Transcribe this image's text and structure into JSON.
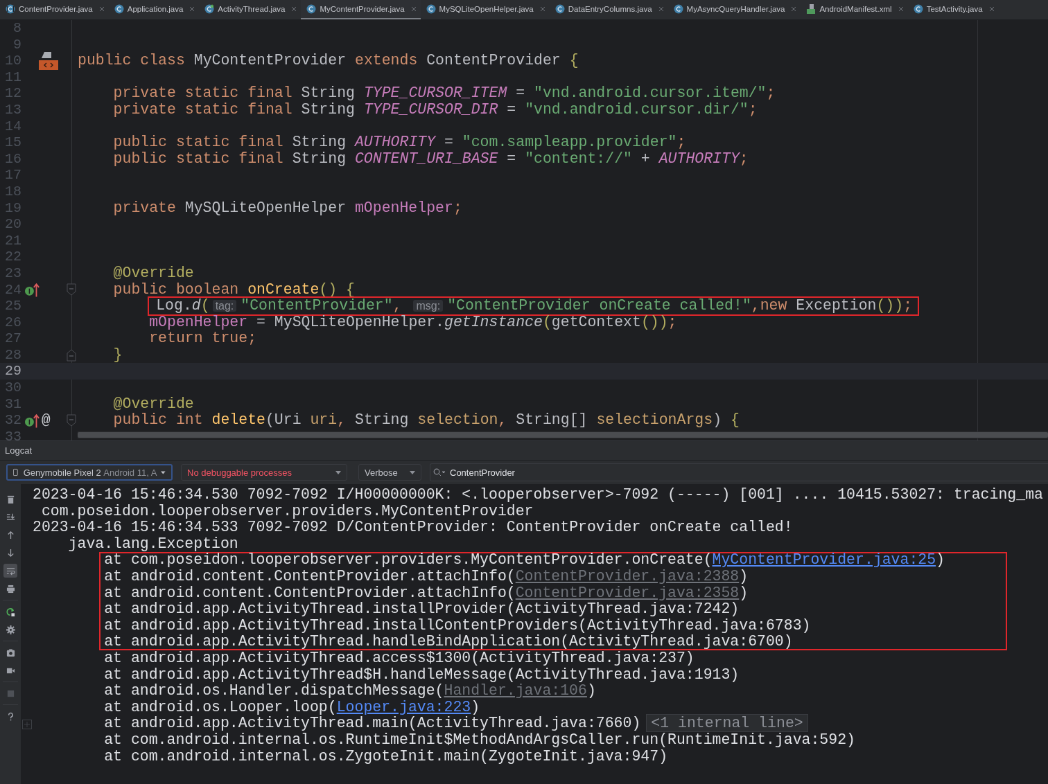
{
  "tabs": [
    {
      "label": "ContentProvider.java",
      "kind": "library_class",
      "selected": false
    },
    {
      "label": "Application.java",
      "kind": "class",
      "selected": false
    },
    {
      "label": "ActivityThread.java",
      "kind": "class_modified",
      "selected": false
    },
    {
      "label": "MyContentProvider.java",
      "kind": "class",
      "selected": true
    },
    {
      "label": "MySQLiteOpenHelper.java",
      "kind": "class",
      "selected": false
    },
    {
      "label": "DataEntryColumns.java",
      "kind": "class",
      "selected": false
    },
    {
      "label": "MyAsyncQueryHandler.java",
      "kind": "class",
      "selected": false
    },
    {
      "label": "AndroidManifest.xml",
      "kind": "manifest",
      "selected": false
    },
    {
      "label": "TestActivity.java",
      "kind": "class",
      "selected": false
    }
  ],
  "editor": {
    "lines": [
      {
        "number": "8",
        "kind": "blank",
        "current": false
      },
      {
        "number": "9",
        "kind": "blank",
        "current": false
      },
      {
        "number": "10",
        "kind": "class_declaration",
        "current": false,
        "tokens": [
          {
            "kind": "kw",
            "text": "public class "
          },
          {
            "kind": "plain",
            "text": "MyContentProvider "
          },
          {
            "kind": "kw",
            "text": "extends "
          },
          {
            "kind": "plain",
            "text": "ContentProvider "
          },
          {
            "kind": "brace",
            "text": "{"
          }
        ]
      },
      {
        "number": "11",
        "kind": "blank",
        "current": false
      },
      {
        "number": "12",
        "kind": "member",
        "current": false,
        "tokens": [
          {
            "kind": "kw",
            "text": "private static final "
          },
          {
            "kind": "plain",
            "text": "String "
          },
          {
            "kind": "const",
            "text": "TYPE_CURSOR_ITEM"
          },
          {
            "kind": "plain",
            "text": " = "
          },
          {
            "kind": "str",
            "text": "\"vnd.android.cursor.item/\""
          },
          {
            "kind": "kw",
            "text": ";"
          }
        ]
      },
      {
        "number": "13",
        "kind": "member",
        "current": false,
        "tokens": [
          {
            "kind": "kw",
            "text": "private static final "
          },
          {
            "kind": "plain",
            "text": "String "
          },
          {
            "kind": "const",
            "text": "TYPE_CURSOR_DIR"
          },
          {
            "kind": "plain",
            "text": " = "
          },
          {
            "kind": "str",
            "text": "\"vnd.android.cursor.dir/\""
          },
          {
            "kind": "kw",
            "text": ";"
          }
        ]
      },
      {
        "number": "14",
        "kind": "blank",
        "current": false
      },
      {
        "number": "15",
        "kind": "member",
        "current": false,
        "tokens": [
          {
            "kind": "kw",
            "text": "public static final "
          },
          {
            "kind": "plain",
            "text": "String "
          },
          {
            "kind": "const",
            "text": "AUTHORITY"
          },
          {
            "kind": "plain",
            "text": " = "
          },
          {
            "kind": "str",
            "text": "\"com.sampleapp.provider\""
          },
          {
            "kind": "kw",
            "text": ";"
          }
        ]
      },
      {
        "number": "16",
        "kind": "member",
        "current": false,
        "tokens": [
          {
            "kind": "kw",
            "text": "public static final "
          },
          {
            "kind": "plain",
            "text": "String "
          },
          {
            "kind": "const",
            "text": "CONTENT_URI_BASE"
          },
          {
            "kind": "plain",
            "text": " = "
          },
          {
            "kind": "str",
            "text": "\"content://\""
          },
          {
            "kind": "plain",
            "text": " + "
          },
          {
            "kind": "const",
            "text": "AUTHORITY"
          },
          {
            "kind": "kw",
            "text": ";"
          }
        ]
      },
      {
        "number": "17",
        "kind": "blank",
        "current": false
      },
      {
        "number": "18",
        "kind": "blank",
        "current": false
      },
      {
        "number": "19",
        "kind": "member",
        "current": false,
        "tokens": [
          {
            "kind": "kw",
            "text": "private "
          },
          {
            "kind": "plain",
            "text": "MySQLiteOpenHelper "
          },
          {
            "kind": "field",
            "text": "mOpenHelper"
          },
          {
            "kind": "kw",
            "text": ";"
          }
        ]
      },
      {
        "number": "20",
        "kind": "blank",
        "current": false
      },
      {
        "number": "21",
        "kind": "blank",
        "current": false
      },
      {
        "number": "22",
        "kind": "blank",
        "current": false
      },
      {
        "number": "23",
        "kind": "member",
        "current": false,
        "tokens": [
          {
            "kind": "ann",
            "text": "@Override"
          }
        ]
      },
      {
        "number": "24",
        "kind": "override_method",
        "current": false,
        "tokens": [
          {
            "kind": "kw",
            "text": "public boolean "
          },
          {
            "kind": "decl",
            "text": "onCreate"
          },
          {
            "kind": "paren",
            "text": "() "
          },
          {
            "kind": "brace",
            "text": "{"
          }
        ]
      },
      {
        "number": "25",
        "kind": "statement",
        "current": false,
        "boxed": true,
        "tokens": [
          {
            "kind": "plain",
            "text": "Log."
          },
          {
            "kind": "smethod",
            "text": "d"
          },
          {
            "kind": "paren",
            "text": "("
          },
          {
            "kind": "hint",
            "text": "tag:"
          },
          {
            "kind": "str",
            "text": "\"ContentProvider\""
          },
          {
            "kind": "kw",
            "text": ", "
          },
          {
            "kind": "hint",
            "text": "msg:"
          },
          {
            "kind": "str",
            "text": "\"ContentProvider onCreate called!\""
          },
          {
            "kind": "kw",
            "text": ","
          },
          {
            "kind": "kw",
            "text": "new "
          },
          {
            "kind": "plain",
            "text": "Exception"
          },
          {
            "kind": "paren",
            "text": "()"
          },
          {
            "kind": "paren",
            "text": ")"
          },
          {
            "kind": "kw",
            "text": ";"
          }
        ]
      },
      {
        "number": "26",
        "kind": "statement",
        "current": false,
        "tokens": [
          {
            "kind": "field",
            "text": "mOpenHelper"
          },
          {
            "kind": "plain",
            "text": " = MySQLiteOpenHelper."
          },
          {
            "kind": "smethod",
            "text": "getInstance"
          },
          {
            "kind": "paren",
            "text": "("
          },
          {
            "kind": "plain",
            "text": "getContext"
          },
          {
            "kind": "paren",
            "text": "()"
          },
          {
            "kind": "paren",
            "text": ")"
          },
          {
            "kind": "kw",
            "text": ";"
          }
        ]
      },
      {
        "number": "27",
        "kind": "statement",
        "current": false,
        "tokens": [
          {
            "kind": "kw",
            "text": "return true;"
          }
        ]
      },
      {
        "number": "28",
        "kind": "block_end",
        "current": false,
        "tokens": [
          {
            "kind": "brace",
            "text": "}"
          }
        ]
      },
      {
        "number": "29",
        "kind": "blank",
        "current": true
      },
      {
        "number": "30",
        "kind": "blank",
        "current": false
      },
      {
        "number": "31",
        "kind": "member",
        "current": false,
        "tokens": [
          {
            "kind": "ann",
            "text": "@Override"
          }
        ]
      },
      {
        "number": "32",
        "kind": "override_method",
        "current": false,
        "marker": "@",
        "tokens": [
          {
            "kind": "kw",
            "text": "public int "
          },
          {
            "kind": "decl",
            "text": "delete"
          },
          {
            "kind": "plain",
            "text": "(Uri "
          },
          {
            "kind": "param",
            "text": "uri"
          },
          {
            "kind": "kw",
            "text": ", "
          },
          {
            "kind": "plain",
            "text": "String "
          },
          {
            "kind": "param",
            "text": "selection"
          },
          {
            "kind": "kw",
            "text": ", "
          },
          {
            "kind": "plain",
            "text": "String[] "
          },
          {
            "kind": "param",
            "text": "selectionArgs"
          },
          {
            "kind": "plain",
            "text": ") "
          },
          {
            "kind": "brace",
            "text": "{"
          }
        ]
      },
      {
        "number": "33",
        "kind": "blank",
        "current": false
      }
    ]
  },
  "logcat": {
    "title": "Logcat",
    "device": {
      "name": "Genymobile Pixel 2",
      "detail": "Android 11, A"
    },
    "process": "No debuggable processes",
    "level": "Verbose",
    "search": {
      "value": "ContentProvider"
    },
    "toolbar": [
      {
        "kind": "clear",
        "selected": false
      },
      {
        "kind": "scroll_end",
        "selected": false
      },
      {
        "kind": "up",
        "selected": false
      },
      {
        "kind": "down",
        "selected": false
      },
      {
        "kind": "wrap",
        "selected": true
      },
      {
        "kind": "print",
        "selected": false
      },
      {
        "kind": "restart",
        "selected": false
      },
      {
        "kind": "settings",
        "selected": false
      },
      {
        "kind": "screenshot",
        "selected": false
      },
      {
        "kind": "record",
        "selected": false
      },
      {
        "kind": "stop",
        "selected": false
      },
      {
        "kind": "help",
        "selected": false
      }
    ],
    "lines": [
      {
        "kind": "entry",
        "boxed": false,
        "segments": [
          {
            "kind": "text",
            "text": "2023-04-16 15:46:34.530 7092-7092 I/H00000000K: <.looperobserver>-7092 (-----) [001] .... 10415.53027: tracing_ma"
          }
        ]
      },
      {
        "kind": "wrapped",
        "boxed": false,
        "segments": [
          {
            "kind": "text",
            "text": "com.poseidon.looperobserver.providers.MyContentProvider"
          }
        ]
      },
      {
        "kind": "entry",
        "boxed": false,
        "segments": [
          {
            "kind": "text",
            "text": "2023-04-16 15:46:34.533 7092-7092 D/ContentProvider: ContentProvider onCreate called!"
          }
        ]
      },
      {
        "kind": "exception",
        "boxed": false,
        "segments": [
          {
            "kind": "text",
            "text": "java.lang.Exception"
          }
        ]
      },
      {
        "kind": "frame",
        "boxed": true,
        "segments": [
          {
            "kind": "text",
            "text": "at com.poseidon.looperobserver.providers.MyContentProvider.onCreate("
          },
          {
            "kind": "link",
            "text": "MyContentProvider.java:25"
          },
          {
            "kind": "text",
            "text": ")"
          }
        ]
      },
      {
        "kind": "frame",
        "boxed": true,
        "segments": [
          {
            "kind": "text",
            "text": "at android.content.ContentProvider.attachInfo("
          },
          {
            "kind": "muted_link",
            "text": "ContentProvider.java:2388"
          },
          {
            "kind": "text",
            "text": ")"
          }
        ]
      },
      {
        "kind": "frame",
        "boxed": true,
        "segments": [
          {
            "kind": "text",
            "text": "at android.content.ContentProvider.attachInfo("
          },
          {
            "kind": "muted_link",
            "text": "ContentProvider.java:2358"
          },
          {
            "kind": "text",
            "text": ")"
          }
        ]
      },
      {
        "kind": "frame",
        "boxed": true,
        "segments": [
          {
            "kind": "text",
            "text": "at android.app.ActivityThread.installProvider(ActivityThread.java:7242)"
          }
        ]
      },
      {
        "kind": "frame",
        "boxed": true,
        "segments": [
          {
            "kind": "text",
            "text": "at android.app.ActivityThread.installContentProviders(ActivityThread.java:6783)"
          }
        ]
      },
      {
        "kind": "frame",
        "boxed": true,
        "segments": [
          {
            "kind": "text",
            "text": "at android.app.ActivityThread.handleBindApplication(ActivityThread.java:6700)"
          }
        ]
      },
      {
        "kind": "frame",
        "boxed": false,
        "segments": [
          {
            "kind": "text",
            "text": "at android.app.ActivityThread.access$1300(ActivityThread.java:237)"
          }
        ]
      },
      {
        "kind": "frame",
        "boxed": false,
        "segments": [
          {
            "kind": "text",
            "text": "at android.app.ActivityThread$H.handleMessage(ActivityThread.java:1913)"
          }
        ]
      },
      {
        "kind": "frame",
        "boxed": false,
        "segments": [
          {
            "kind": "text",
            "text": "at android.os.Handler.dispatchMessage("
          },
          {
            "kind": "muted_link",
            "text": "Handler.java:106"
          },
          {
            "kind": "text",
            "text": ")"
          }
        ]
      },
      {
        "kind": "frame",
        "boxed": false,
        "segments": [
          {
            "kind": "text",
            "text": "at android.os.Looper.loop("
          },
          {
            "kind": "link",
            "text": "Looper.java:223"
          },
          {
            "kind": "text",
            "text": ")"
          }
        ]
      },
      {
        "kind": "frame",
        "boxed": false,
        "segments": [
          {
            "kind": "text",
            "text": "at android.app.ActivityThread.main(ActivityThread.java:7660)"
          },
          {
            "kind": "folded",
            "text": "<1 internal line>"
          }
        ]
      },
      {
        "kind": "frame",
        "boxed": false,
        "segments": [
          {
            "kind": "text",
            "text": "at com.android.internal.os.RuntimeInit$MethodAndArgsCaller.run(RuntimeInit.java:592)"
          }
        ]
      },
      {
        "kind": "frame",
        "boxed": false,
        "segments": [
          {
            "kind": "text",
            "text": "at com.android.internal.os.ZygoteInit.main(ZygoteInit.java:947)"
          }
        ]
      }
    ]
  }
}
